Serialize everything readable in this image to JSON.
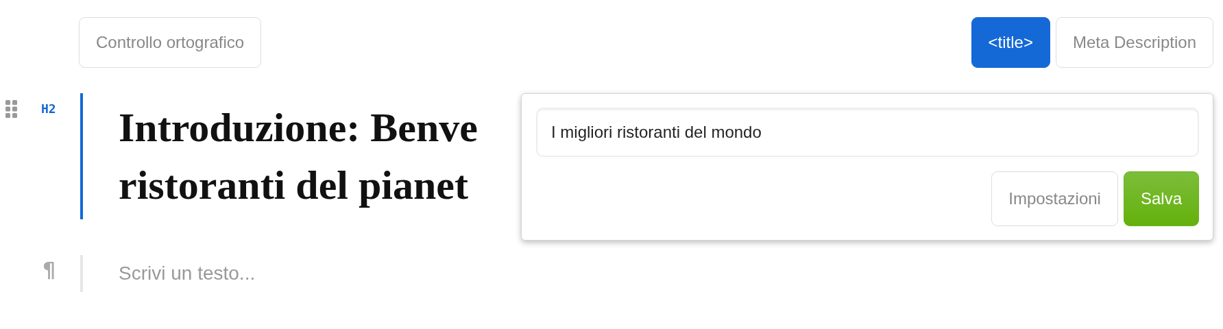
{
  "toolbar": {
    "spellcheck_button": "Controllo ortografico",
    "tabs": [
      {
        "label": "<title>",
        "selected": true
      },
      {
        "label": "Meta Description",
        "selected": false
      }
    ]
  },
  "blocks": [
    {
      "kind": "heading",
      "level_tag": "H2",
      "selected": true,
      "lines": [
        "Introduzione: Benve",
        "ristoranti del pianet"
      ]
    },
    {
      "kind": "paragraph",
      "marker": "¶",
      "selected": false,
      "placeholder": "Scrivi un testo..."
    }
  ],
  "popup": {
    "title_field": {
      "value": "I migliori ristoranti del mondo"
    },
    "buttons": [
      {
        "label": "Impostazioni",
        "kind": "secondary"
      },
      {
        "label": "Salva",
        "kind": "primary"
      }
    ]
  }
}
